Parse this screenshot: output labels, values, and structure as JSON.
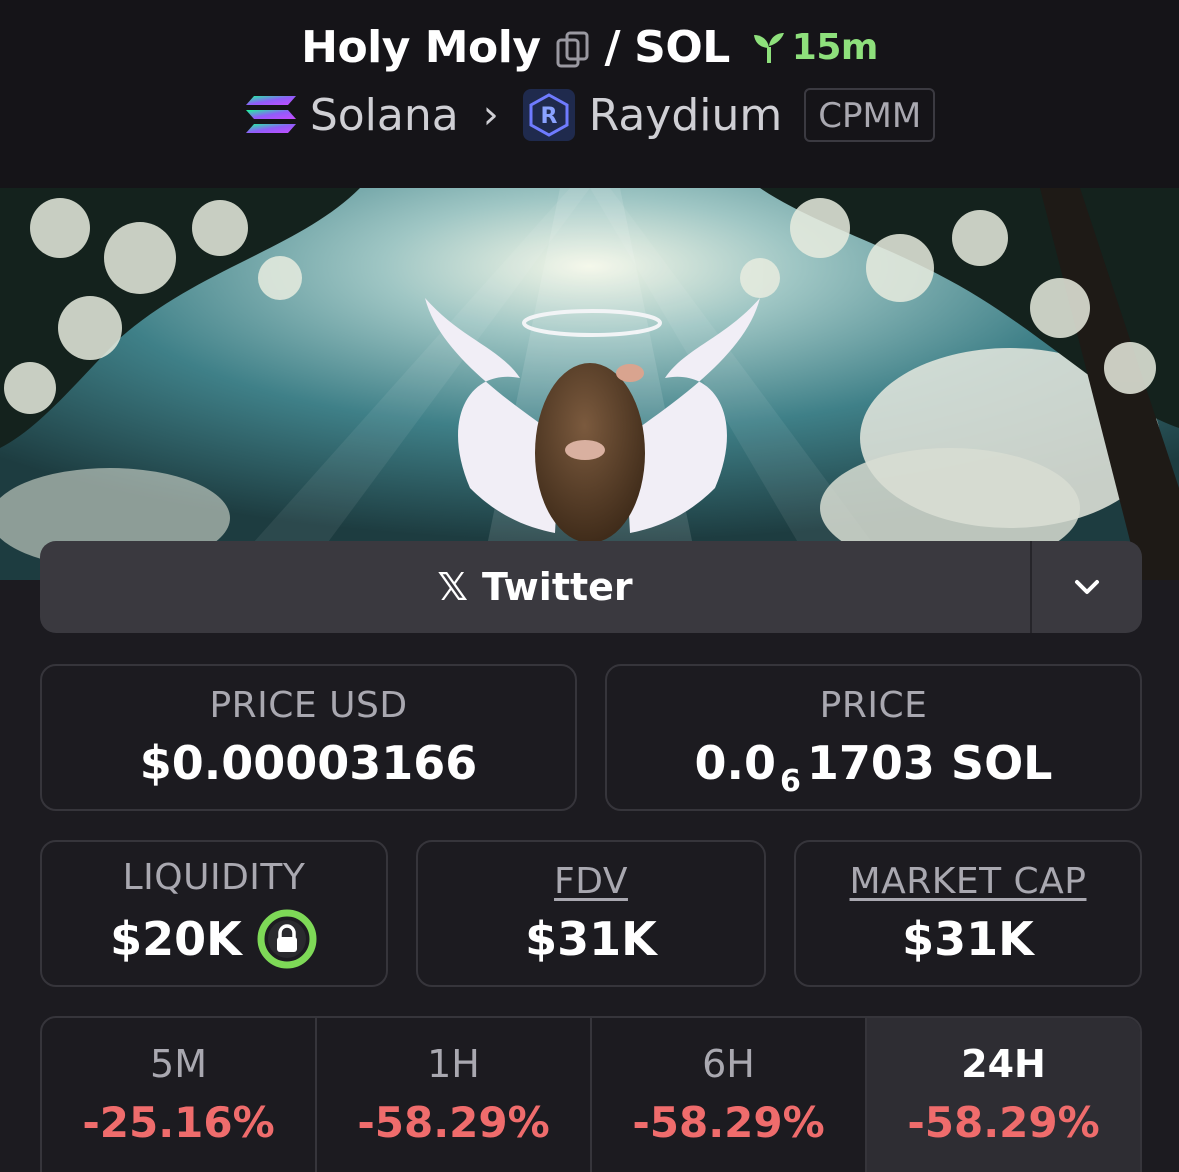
{
  "header": {
    "token_name": "Holy Moly",
    "separator": "/",
    "quote_symbol": "SOL",
    "age": "15m",
    "chain": "Solana",
    "dex": "Raydium",
    "pool_type": "CPMM"
  },
  "links": {
    "twitter_label": "Twitter"
  },
  "stats": {
    "price_usd_label": "PRICE USD",
    "price_usd_value": "$0.00003166",
    "price_label": "PRICE",
    "price_prefix": "0.0",
    "price_zero_count": "6",
    "price_suffix": "1703 SOL",
    "liquidity_label": "LIQUIDITY",
    "liquidity_value": "$20K",
    "fdv_label": "FDV",
    "fdv_value": "$31K",
    "mcap_label": "MARKET CAP",
    "mcap_value": "$31K"
  },
  "changes": [
    {
      "period": "5M",
      "pct": "-25.16%"
    },
    {
      "period": "1H",
      "pct": "-58.29%"
    },
    {
      "period": "6H",
      "pct": "-58.29%"
    },
    {
      "period": "24H",
      "pct": "-58.29%"
    }
  ],
  "colors": {
    "positive_age": "#8ee07c",
    "negative": "#ef6c6c",
    "lock_ring": "#7ed957"
  }
}
